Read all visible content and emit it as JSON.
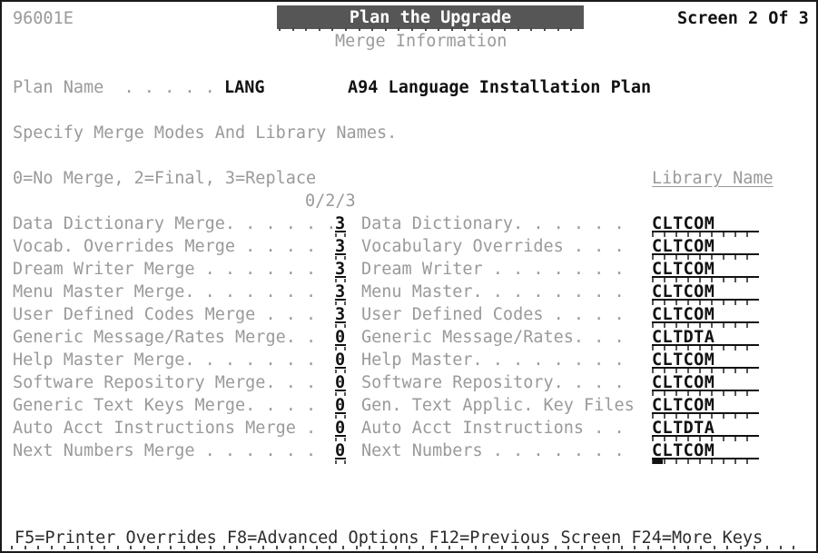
{
  "theme": {
    "background": "#ffffff",
    "border": "#1a1a1a",
    "dim_text": "#9a9a9a",
    "bright_text": "#111111",
    "title_bar_bg": "#565656",
    "title_bar_fg": "#ffffff"
  },
  "header": {
    "screen_id": "96001E",
    "title": "Plan the Upgrade",
    "subtitle": "Merge Information",
    "screen_count": "Screen 2 Of 3"
  },
  "plan": {
    "label": "Plan Name  . . . . . .",
    "code": "LANG",
    "description": "A94 Language Installation Plan"
  },
  "instructions": {
    "specify": "Specify Merge Modes And Library Names.",
    "legend": "0=No Merge, 2=Final, 3=Replace",
    "legend_values": "0/2/3",
    "library_header": "Library Name"
  },
  "rows": [
    {
      "merge_label": "Data Dictionary Merge. . . . . .",
      "mode": "3",
      "file_label": "Data Dictionary. . . . . .",
      "library": "CLTCOM",
      "cursor": false
    },
    {
      "merge_label": "Vocab. Overrides Merge . . . .",
      "mode": "3",
      "file_label": "Vocabulary Overrides . . .",
      "library": "CLTCOM",
      "cursor": false
    },
    {
      "merge_label": "Dream Writer Merge . . . . . .",
      "mode": "3",
      "file_label": "Dream Writer . . . . . . .",
      "library": "CLTCOM",
      "cursor": false
    },
    {
      "merge_label": "Menu Master Merge. . . . . . .",
      "mode": "3",
      "file_label": "Menu Master. . . . . . . .",
      "library": "CLTCOM",
      "cursor": false
    },
    {
      "merge_label": "User Defined Codes Merge . . .",
      "mode": "3",
      "file_label": "User Defined Codes . . . .",
      "library": "CLTCOM",
      "cursor": false
    },
    {
      "merge_label": "Generic Message/Rates Merge. .",
      "mode": "0",
      "file_label": "Generic Message/Rates. . .",
      "library": "CLTDTA",
      "cursor": false
    },
    {
      "merge_label": "Help Master Merge. . . . . . .",
      "mode": "0",
      "file_label": "Help Master. . . . . . . .",
      "library": "CLTCOM",
      "cursor": false
    },
    {
      "merge_label": "Software Repository Merge. . .",
      "mode": "0",
      "file_label": "Software Repository. . . .",
      "library": "CLTCOM",
      "cursor": false
    },
    {
      "merge_label": "Generic Text Keys Merge. . . .",
      "mode": "0",
      "file_label": "Gen. Text Applic. Key Files",
      "library": "CLTCOM",
      "cursor": false
    },
    {
      "merge_label": "Auto Acct Instructions Merge .",
      "mode": "0",
      "file_label": "Auto Acct Instructions . .",
      "library": "CLTDTA",
      "cursor": false
    },
    {
      "merge_label": "Next Numbers Merge . . . . . .",
      "mode": "0",
      "file_label": "Next Numbers . . . . . . .",
      "library": "CLTCOM",
      "cursor": true
    }
  ],
  "footer": {
    "function_keys": "F5=Printer Overrides F8=Advanced Options F12=Previous Screen F24=More Keys"
  }
}
